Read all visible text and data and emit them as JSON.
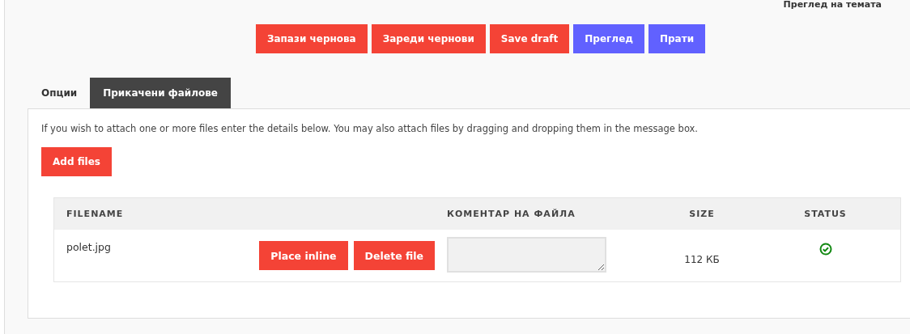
{
  "header_link": "Преглед на темата",
  "actions": [
    {
      "label": "Запази чернова",
      "kind": "danger"
    },
    {
      "label": "Зареди чернови",
      "kind": "danger"
    },
    {
      "label": "Save draft",
      "kind": "danger"
    },
    {
      "label": "Преглед",
      "kind": "primary"
    },
    {
      "label": "Прати",
      "kind": "primary"
    }
  ],
  "tabs": [
    {
      "label": "Опции",
      "selected": false
    },
    {
      "label": "Прикачени файлове",
      "selected": true
    }
  ],
  "panel": {
    "intro": "If you wish to attach one or more files enter the details below. You may also attach files by dragging and dropping them in the message box.",
    "add_button": "Add files",
    "table": {
      "columns": [
        "FILENAME",
        "КОМЕНТАР НА ФАЙЛА",
        "SIZE",
        "STATUS"
      ],
      "rows": [
        {
          "filename": "polet.jpg",
          "buttons": [
            "Place inline",
            "Delete file"
          ],
          "size": "112 КБ",
          "uploaded": true
        }
      ]
    }
  }
}
